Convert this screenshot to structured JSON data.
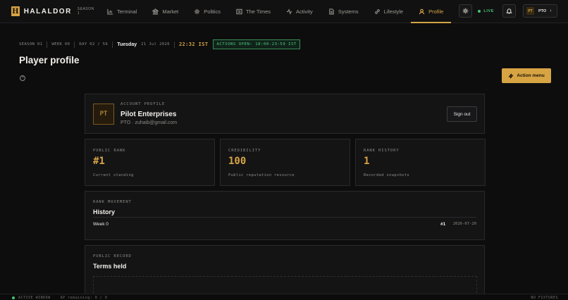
{
  "brand": {
    "name": "HALALDOR",
    "logo_letter": "H",
    "season_tag": "SEASON 1"
  },
  "nav": {
    "items": [
      {
        "label": "Terminal",
        "icon": "chart-icon"
      },
      {
        "label": "Market",
        "icon": "bank-icon"
      },
      {
        "label": "Politics",
        "icon": "gear-icon"
      },
      {
        "label": "The Times",
        "icon": "newspaper-icon"
      },
      {
        "label": "Activity",
        "icon": "pulse-icon"
      },
      {
        "label": "Systems",
        "icon": "document-icon"
      },
      {
        "label": "Lifestyle",
        "icon": "link-icon"
      },
      {
        "label": "Profile",
        "icon": "user-icon",
        "active": true
      }
    ],
    "live_label": "LIVE",
    "user": {
      "initials": "PT",
      "name": "PTO"
    }
  },
  "status": {
    "season": "SEASON 01",
    "week": "WEEK 00",
    "day": "DAY 02 / 56",
    "weekday": "Tuesday",
    "date": "21 Jul 2026",
    "clock": "22:32 IST",
    "actions_window": "ACTIONS OPEN: 18:00-23:59 IST"
  },
  "page": {
    "title": "Player profile",
    "help": "?",
    "action_menu": "Action menu"
  },
  "profile": {
    "label": "ACCOUNT PROFILE",
    "initials": "PT",
    "name": "Pilot Enterprises",
    "sub": "PTO · zuhaib@gmail.com",
    "signout": "Sign out"
  },
  "stats": [
    {
      "label": "PUBLIC RANK",
      "value": "#1",
      "desc": "Current standing"
    },
    {
      "label": "CREDIBILITY",
      "value": "100",
      "desc": "Public reputation resource"
    },
    {
      "label": "RANK HISTORY",
      "value": "1",
      "desc": "Recorded snapshots"
    }
  ],
  "movement": {
    "label": "RANK MOVEMENT",
    "title": "History",
    "rows": [
      {
        "week": "Week 0",
        "rank": "#1",
        "date": "2026-07-20"
      }
    ]
  },
  "record": {
    "label": "PUBLIC RECORD",
    "title": "Terms held",
    "empty": ""
  },
  "footer": {
    "window": "ACTIVE WINDOW",
    "ap": "AP remaining: 0 / 0",
    "fixtures": "NO FIXTURES"
  },
  "colors": {
    "accent": "#d7a444",
    "live": "#46c373",
    "background": "#0d0d0e"
  }
}
